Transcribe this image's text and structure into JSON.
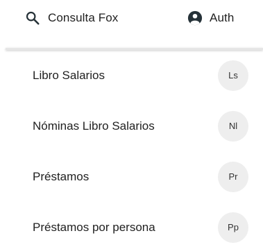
{
  "toolbar": {
    "search_link": {
      "icon": "search-icon",
      "label": "Consulta Fox"
    },
    "auth_link": {
      "icon": "account-circle-icon",
      "label": "Auth"
    }
  },
  "menu": {
    "items": [
      {
        "label": "Libro Salarios",
        "avatar": "Ls"
      },
      {
        "label": "Nóminas Libro Salarios",
        "avatar": "Nl"
      },
      {
        "label": "Préstamos",
        "avatar": "Pr"
      },
      {
        "label": "Préstamos por persona",
        "avatar": "Pp"
      }
    ]
  },
  "colors": {
    "text": "#212121",
    "avatar_bg": "#eeeeee",
    "divider": "#e6e6e6"
  }
}
